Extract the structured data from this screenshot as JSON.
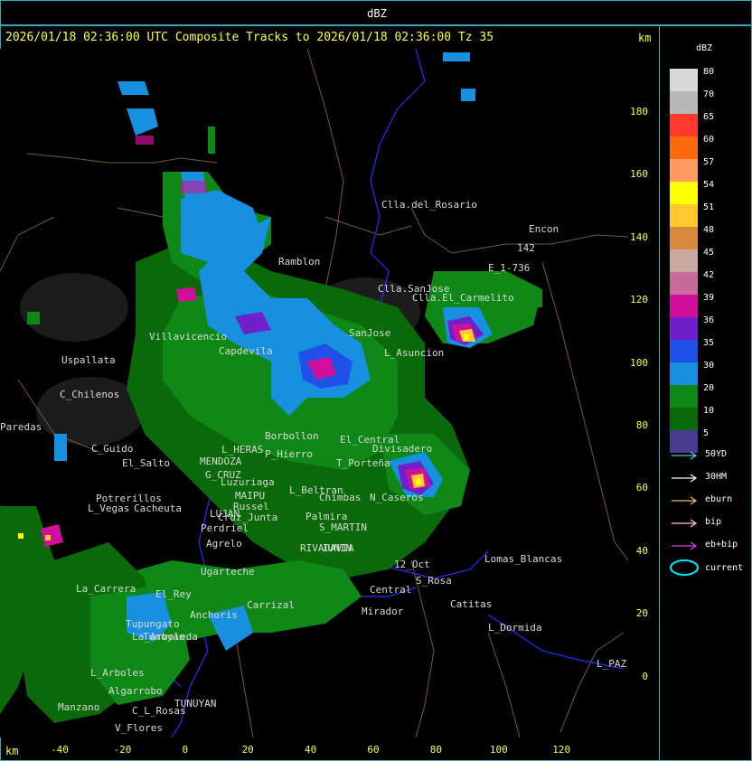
{
  "top_title": "dBZ",
  "header": "2026/01/18 02:36:00 UTC Composite Tracks to 2026/01/18 02:36:00 Tz 35",
  "km_label": "km",
  "y_ticks": [
    "180",
    "160",
    "140",
    "120",
    "100",
    "80",
    "60",
    "40",
    "20",
    "0"
  ],
  "x_ticks": [
    "-40",
    "-20",
    "0",
    "20",
    "40",
    "60",
    "80",
    "100",
    "120"
  ],
  "legend": {
    "title": "dBZ",
    "colors": [
      {
        "label": "80",
        "color": "#d8d8d8"
      },
      {
        "label": "70",
        "color": "#b8b8b8"
      },
      {
        "label": "65",
        "color": "#ff3a2a"
      },
      {
        "label": "60",
        "color": "#ff6a10"
      },
      {
        "label": "57",
        "color": "#ff9a60"
      },
      {
        "label": "54",
        "color": "#ffff00"
      },
      {
        "label": "51",
        "color": "#ffc830"
      },
      {
        "label": "48",
        "color": "#d88a3a"
      },
      {
        "label": "45",
        "color": "#c8a8a0"
      },
      {
        "label": "42",
        "color": "#c86a9a"
      },
      {
        "label": "39",
        "color": "#d0109a"
      },
      {
        "label": "36",
        "color": "#7020c8"
      },
      {
        "label": "35",
        "color": "#2050e8"
      },
      {
        "label": "30",
        "color": "#1890e0"
      },
      {
        "label": "20",
        "color": "#108818"
      },
      {
        "label": "10",
        "color": "#0a6a0a"
      },
      {
        "label": "5",
        "color": "#483a90"
      }
    ],
    "tracks": [
      {
        "label": "50YD",
        "color": "#40d0e0"
      },
      {
        "label": "30HM",
        "color": "#ffffff"
      },
      {
        "label": "eburn",
        "color": "#e8c070"
      },
      {
        "label": "bip",
        "color": "#ffc8c8"
      },
      {
        "label": "eb+bip",
        "color": "#e040e0"
      }
    ],
    "current": "current"
  },
  "places": [
    {
      "name": "Clla.del_Rosario"
    },
    {
      "name": "Encon"
    },
    {
      "name": "142"
    },
    {
      "name": "E_1-736"
    },
    {
      "name": "Ramblon"
    },
    {
      "name": "Clla.SanJose"
    },
    {
      "name": "Clla.El_Carmelito"
    },
    {
      "name": "Villavicencio"
    },
    {
      "name": "SanJose"
    },
    {
      "name": "Capdevila"
    },
    {
      "name": "L_Asuncion"
    },
    {
      "name": "Uspallata"
    },
    {
      "name": "C_Chilenos"
    },
    {
      "name": "Paredas"
    },
    {
      "name": "Borbollon"
    },
    {
      "name": "El_Central"
    },
    {
      "name": "Divisadero"
    },
    {
      "name": "C_Guido"
    },
    {
      "name": "L_HERAS"
    },
    {
      "name": "P_Hierro"
    },
    {
      "name": "T_Porteña"
    },
    {
      "name": "El_Salto"
    },
    {
      "name": "MENDOZA"
    },
    {
      "name": "G_CRUZ"
    },
    {
      "name": "Luzuriaga"
    },
    {
      "name": "L_Beltran"
    },
    {
      "name": "Chimbas"
    },
    {
      "name": "N_Caseros"
    },
    {
      "name": "Potrerillos"
    },
    {
      "name": "MAIPU"
    },
    {
      "name": "L_Vegas"
    },
    {
      "name": "Cacheuta"
    },
    {
      "name": "Russel"
    },
    {
      "name": "LUJAN"
    },
    {
      "name": "Palmira"
    },
    {
      "name": "Cruz_Junta"
    },
    {
      "name": "Perdriel"
    },
    {
      "name": "S_MARTIN"
    },
    {
      "name": "Agrelo"
    },
    {
      "name": "RIVADAVIA"
    },
    {
      "name": "JUNIN"
    },
    {
      "name": "Lomas_Blancas"
    },
    {
      "name": "La_Carrera"
    },
    {
      "name": "Ugarteche"
    },
    {
      "name": "S_Rosa"
    },
    {
      "name": "Catitas"
    },
    {
      "name": "El_Rey"
    },
    {
      "name": "Carrizal"
    },
    {
      "name": "Tupungato"
    },
    {
      "name": "Anchoris"
    },
    {
      "name": "Mirador"
    },
    {
      "name": "L_Dormida"
    },
    {
      "name": "Tunuyan"
    },
    {
      "name": "La_Arboleda"
    },
    {
      "name": "L_Arboles"
    },
    {
      "name": "L_PAZ"
    },
    {
      "name": "Algarrobo"
    },
    {
      "name": "TUNUYAN"
    },
    {
      "name": "Manzano"
    },
    {
      "name": "V_Flores"
    },
    {
      "name": "C_L_Rosas"
    },
    {
      "name": "Central"
    },
    {
      "name": "12_Oct"
    }
  ]
}
